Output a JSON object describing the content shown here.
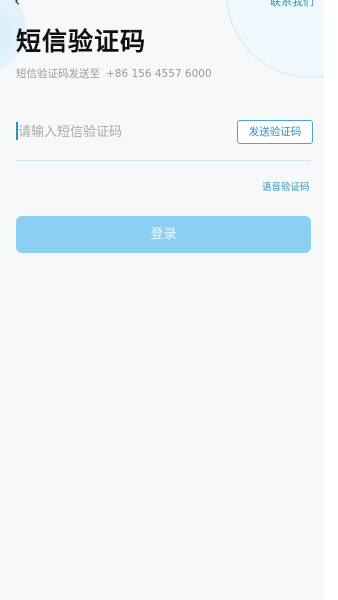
{
  "header": {
    "back_icon": "back-arrow-icon",
    "top_right_link": "联系我们"
  },
  "page": {
    "title": "短信验证码",
    "subtitle_prefix": "短信验证码发送至",
    "phone": "+86  156 4557 6000"
  },
  "code_field": {
    "value": "",
    "placeholder": "请输入短信验证码"
  },
  "send_code_label": "发送验证码",
  "voice_code_label": "语音验证码",
  "login_label": "登录",
  "colors": {
    "accent": "#2e8fbf",
    "login_button": "#8dcff2",
    "background": "#f7f8f9"
  }
}
